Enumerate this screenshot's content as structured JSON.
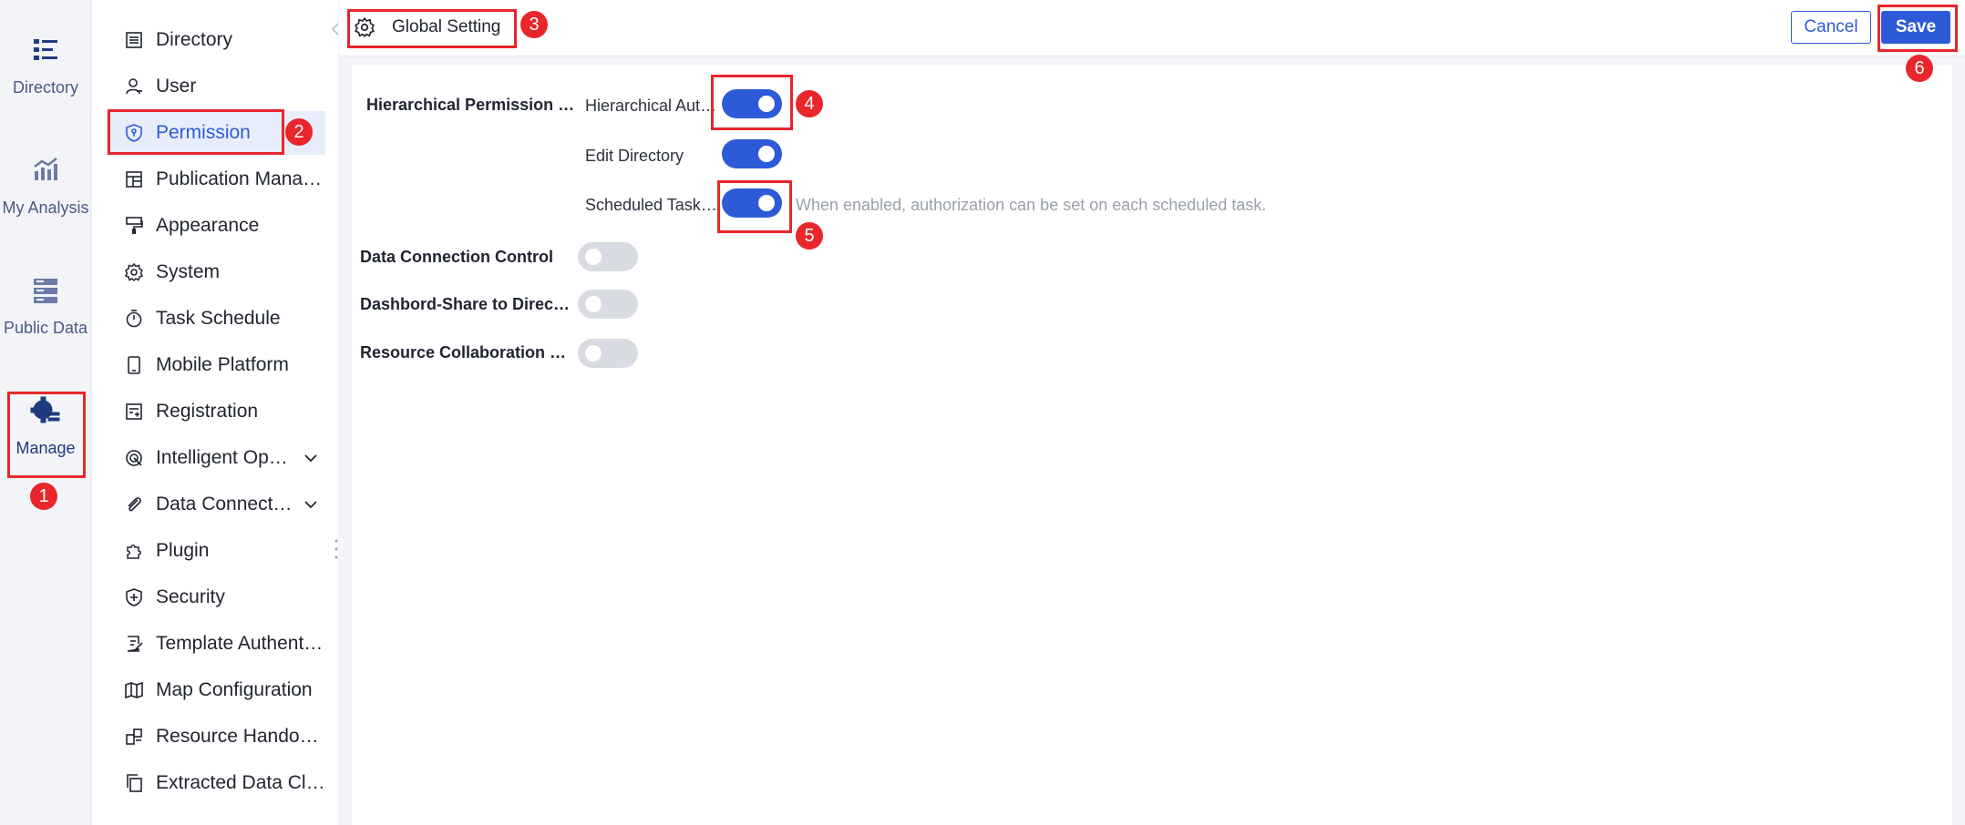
{
  "rail": {
    "items": [
      {
        "label": "Directory",
        "icon": "directory-list-icon"
      },
      {
        "label": "My Analysis",
        "icon": "analysis-chart-icon"
      },
      {
        "label": "Public Data",
        "icon": "database-icon"
      },
      {
        "label": "Manage",
        "icon": "manage-gear-icon",
        "active": true
      }
    ]
  },
  "sidebar": {
    "items": [
      {
        "label": "Directory",
        "icon": "list-icon"
      },
      {
        "label": "User",
        "icon": "user-icon"
      },
      {
        "label": "Permission",
        "icon": "shield-icon",
        "active": true
      },
      {
        "label": "Publication Management",
        "icon": "layout-icon"
      },
      {
        "label": "Appearance",
        "icon": "brush-icon"
      },
      {
        "label": "System",
        "icon": "gear-icon"
      },
      {
        "label": "Task Schedule",
        "icon": "timer-icon"
      },
      {
        "label": "Mobile Platform",
        "icon": "mobile-icon"
      },
      {
        "label": "Registration",
        "icon": "registration-icon"
      },
      {
        "label": "Intelligent Operation",
        "icon": "radar-icon",
        "expandable": true
      },
      {
        "label": "Data Connection",
        "icon": "paperclip-icon",
        "expandable": true
      },
      {
        "label": "Plugin",
        "icon": "puzzle-icon"
      },
      {
        "label": "Security",
        "icon": "security-shield-icon"
      },
      {
        "label": "Template Authentication",
        "icon": "template-icon"
      },
      {
        "label": "Map Configuration",
        "icon": "map-icon"
      },
      {
        "label": "Resource Handover",
        "icon": "handover-icon"
      },
      {
        "label": "Extracted Data Cleanup",
        "icon": "copy-icon"
      }
    ]
  },
  "topbar": {
    "tab_label": "Global Setting",
    "cancel_label": "Cancel",
    "save_label": "Save"
  },
  "settings": {
    "hierarchical_label": "Hierarchical Permission Management",
    "hierarchical_auth_label": "Hierarchical Authorization",
    "edit_directory_label": "Edit Directory",
    "scheduled_task_label": "Scheduled Task Authorization",
    "scheduled_task_hint": "When enabled, authorization can be set on each scheduled task.",
    "data_connection_label": "Data Connection Control",
    "dashboard_share_label": "Dashbord-Share to Directory",
    "resource_collab_label": "Resource Collaboration Control",
    "toggles": {
      "hierarchical_auth": true,
      "edit_directory": true,
      "scheduled_task": true,
      "data_connection": false,
      "dashboard_share": false,
      "resource_collab": false
    }
  },
  "annotations": [
    "1",
    "2",
    "3",
    "4",
    "5",
    "6"
  ],
  "colors": {
    "accent": "#2d5bd8",
    "highlight": "#e8262b",
    "toggle_off": "#d8dbe1",
    "active_bg": "#e7edfb"
  }
}
